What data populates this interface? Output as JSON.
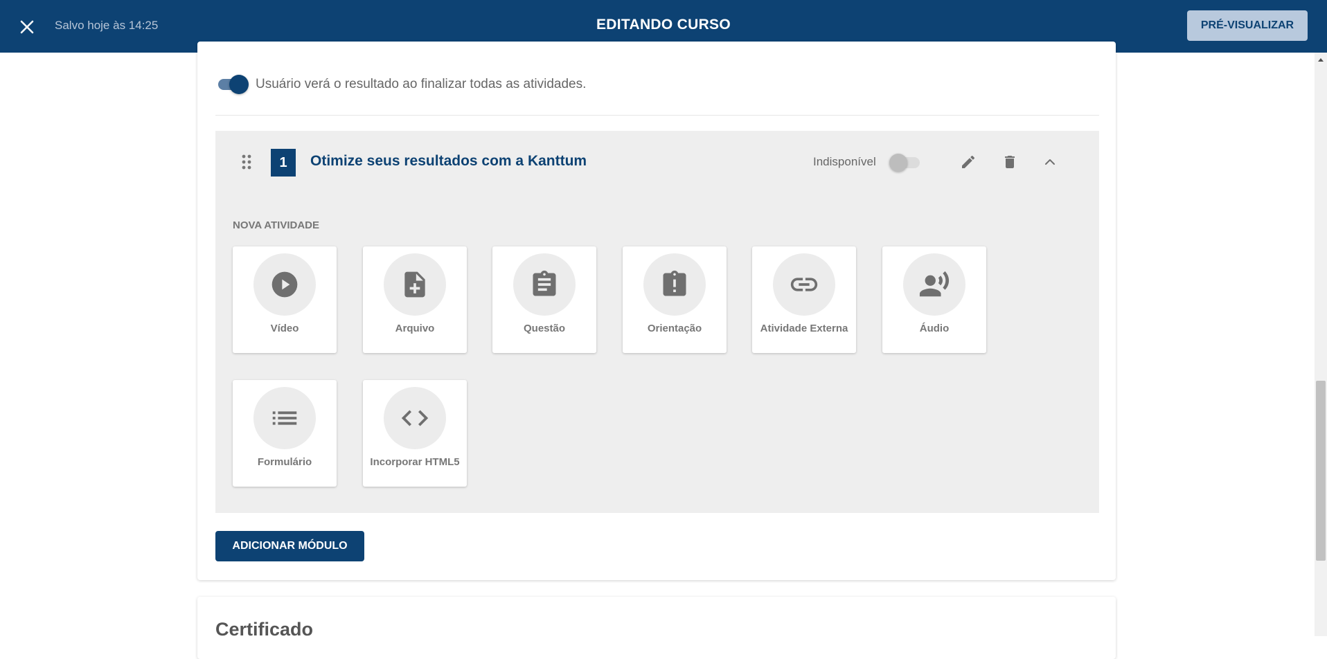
{
  "header": {
    "saved_text": "Salvo hoje às 14:25",
    "title": "EDITANDO CURSO",
    "preview_label": "PRÉ-VISUALIZAR"
  },
  "results": {
    "toggle_on": true,
    "text": "Usuário verá o resultado ao finalizar todas as atividades."
  },
  "module": {
    "number": "1",
    "title": "Otimize seus resultados com a Kanttum",
    "availability_label": "Indisponível",
    "available": false
  },
  "new_activity": {
    "heading": "NOVA ATIVIDADE",
    "items": [
      {
        "label": "Vídeo",
        "icon": "play-circle-icon"
      },
      {
        "label": "Arquivo",
        "icon": "file-add-icon"
      },
      {
        "label": "Questão",
        "icon": "clipboard-icon"
      },
      {
        "label": "Orientação",
        "icon": "alert-clipboard-icon"
      },
      {
        "label": "Atividade Externa",
        "icon": "link-icon"
      },
      {
        "label": "Áudio",
        "icon": "speaker-person-icon"
      },
      {
        "label": "Formulário",
        "icon": "list-icon"
      },
      {
        "label": "Incorporar HTML5",
        "icon": "code-icon"
      }
    ]
  },
  "add_module_label": "ADICIONAR MÓDULO",
  "certificate": {
    "title": "Certificado"
  },
  "colors": {
    "brand": "#0d4273",
    "preview_button": "#b8c9dd",
    "module_bg": "#eeeeee",
    "icon_gray": "#6f6f6f"
  }
}
